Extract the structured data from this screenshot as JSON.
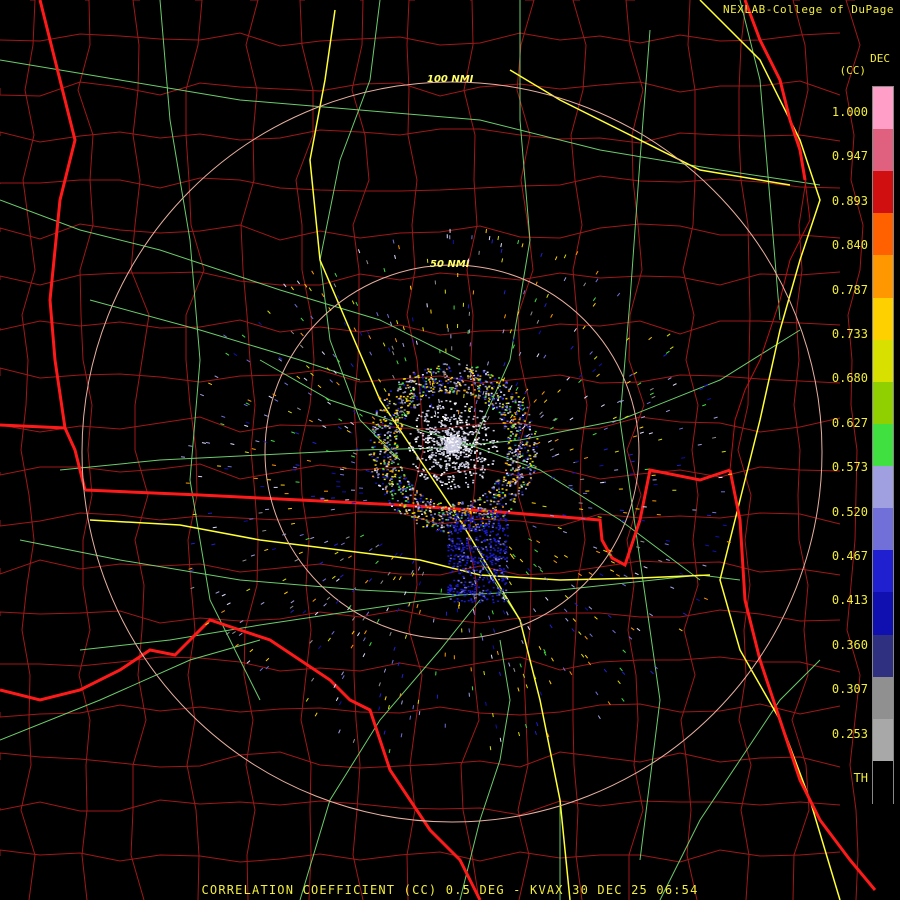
{
  "credit": "NEXLAB-College of DuPage",
  "product_line": "CORRELATION COEFFICIENT (CC) 0.5 DEG - KVAX 30 DEC 25 06:54",
  "units_top": "DEC",
  "units_sub": "(CC)",
  "range_rings": [
    {
      "label": "100 NMI"
    },
    {
      "label": "50 NMI"
    }
  ],
  "colorbar": {
    "ticks": [
      "1.000",
      "0.947",
      "0.893",
      "0.840",
      "0.787",
      "0.733",
      "0.680",
      "0.627",
      "0.573",
      "0.520",
      "0.467",
      "0.413",
      "0.360",
      "0.307",
      "0.253",
      "TH"
    ],
    "colors": [
      "#ff9fc8",
      "#e0607f",
      "#d01010",
      "#ff6000",
      "#ff9800",
      "#ffd000",
      "#d8e000",
      "#90d000",
      "#40e040",
      "#a0a0e0",
      "#7070d8",
      "#2020d0",
      "#1010b0",
      "#303080",
      "#909090",
      "#a8a8a8",
      "#000000"
    ]
  },
  "colors": {
    "state_border": "#ff1a1a",
    "county_border": "#a01818",
    "highway": "#ffff33",
    "roads": "#80ff80",
    "range_ring": "#e8b0a0",
    "text": "#f2ee3a"
  }
}
